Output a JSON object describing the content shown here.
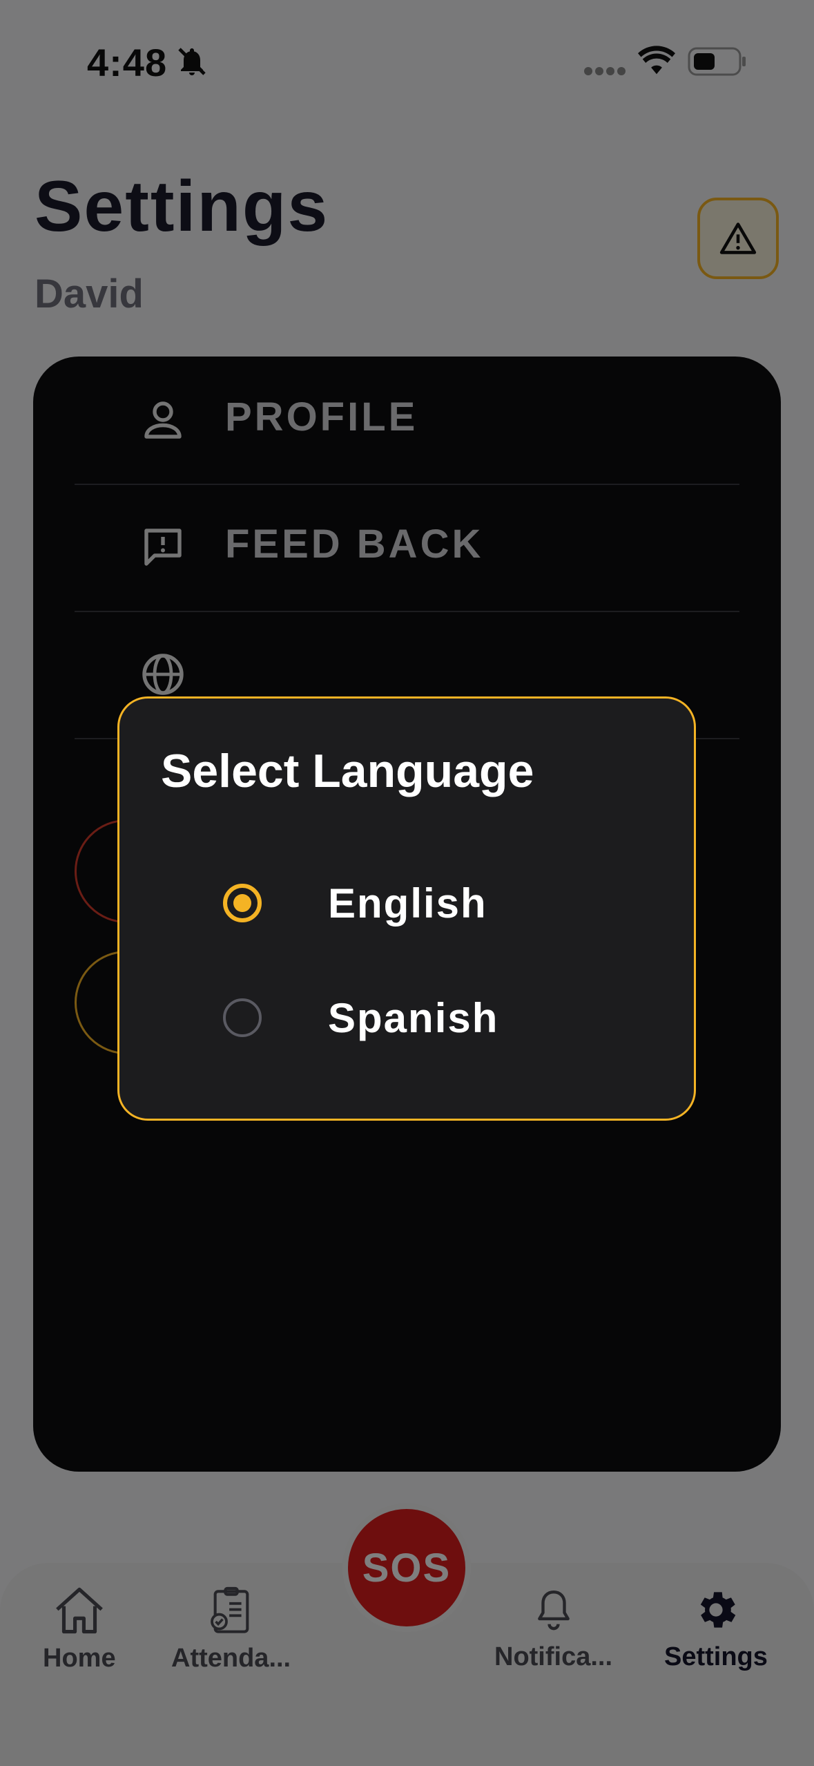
{
  "status_bar": {
    "time": "4:48"
  },
  "header": {
    "title": "Settings",
    "user_name": "David"
  },
  "menu": {
    "items": [
      {
        "label": "PROFILE",
        "icon": "person-icon"
      },
      {
        "label": "FEED BACK",
        "icon": "feedback-icon"
      },
      {
        "label": "",
        "icon": "globe-icon"
      }
    ]
  },
  "dialog": {
    "title": "Select Language",
    "options": [
      {
        "label": "English",
        "selected": true
      },
      {
        "label": "Spanish",
        "selected": false
      }
    ]
  },
  "bottom_nav": {
    "items": [
      {
        "label": "Home"
      },
      {
        "label": "Attenda..."
      },
      {
        "label": "Notifica..."
      },
      {
        "label": "Settings",
        "active": true
      }
    ],
    "sos_label": "SOS"
  },
  "colors": {
    "accent": "#f4b324",
    "sos": "#dd1d1d",
    "card": "#0c0c0e",
    "dialog": "#1c1c1e"
  }
}
